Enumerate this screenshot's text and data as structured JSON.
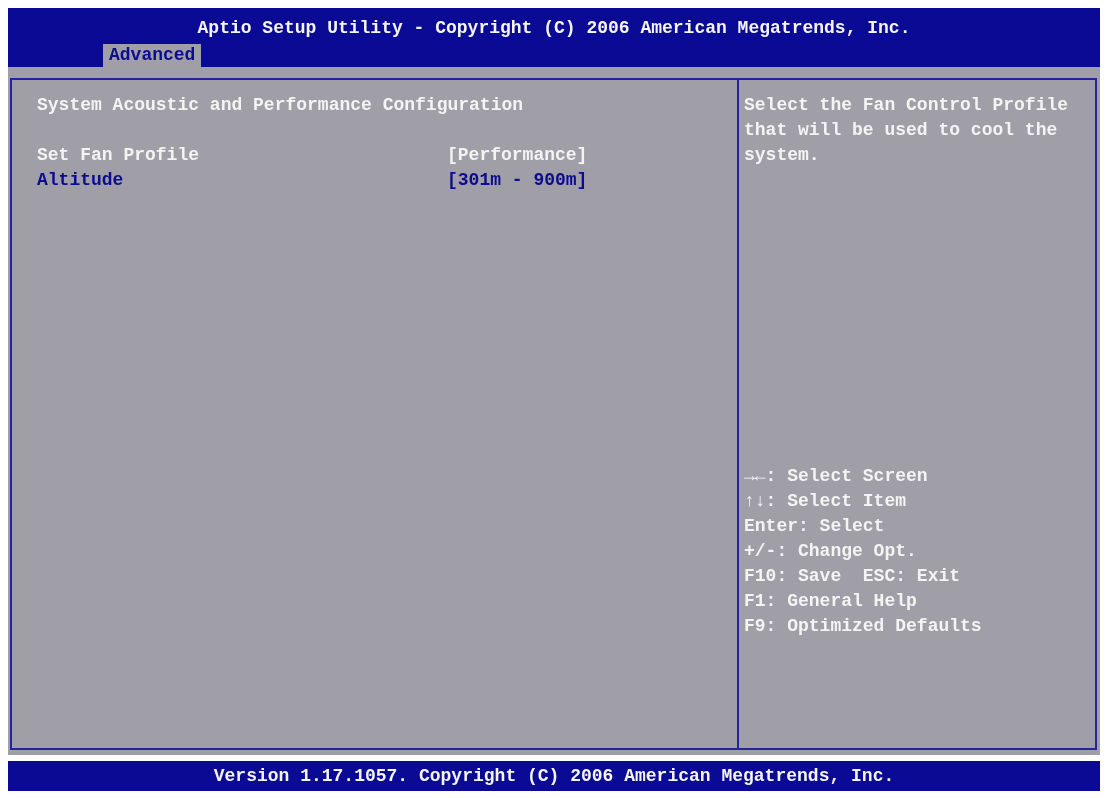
{
  "window": {
    "title": "Aptio Setup Utility - Copyright (C) 2006 American Megatrends, Inc."
  },
  "tabs": [
    {
      "label": "Advanced",
      "selected": true
    }
  ],
  "page": {
    "heading": "System Acoustic and Performance Configuration",
    "settings": [
      {
        "label": "Set Fan Profile",
        "value": "[Performance]",
        "selected": true
      },
      {
        "label": "Altitude",
        "value": "[301m - 900m]",
        "selected": false
      }
    ]
  },
  "help": {
    "description": "Select the Fan Control Profile that will be used to cool the system.",
    "keys": [
      "→←: Select Screen",
      "↑↓: Select Item",
      "Enter: Select",
      "+/-: Change Opt.",
      "F10: Save  ESC: Exit",
      "F1: General Help",
      "F9: Optimized Defaults"
    ]
  },
  "status_bar": {
    "text": "Version 1.17.1057. Copyright (C) 2006 American Megatrends, Inc."
  }
}
